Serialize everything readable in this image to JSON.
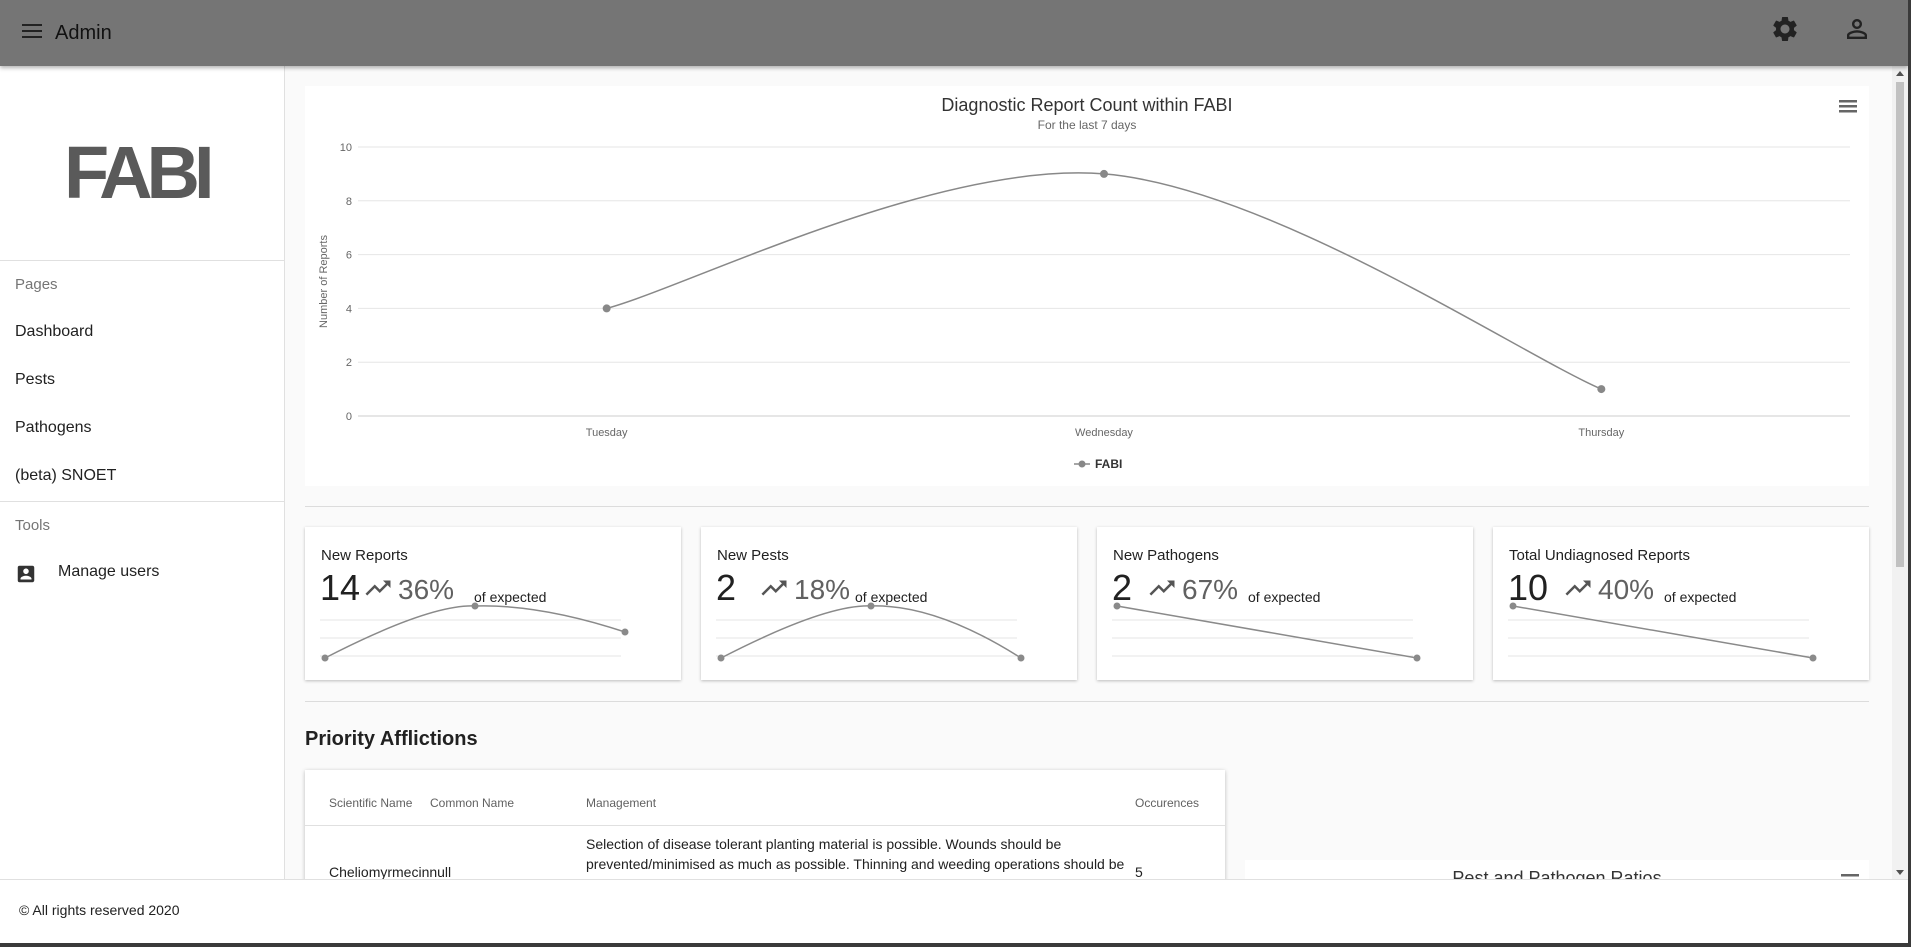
{
  "appbar": {
    "title": "Admin",
    "menu_icon": "menu-icon",
    "settings_icon": "gear-icon",
    "account_icon": "person-icon"
  },
  "sidebar": {
    "logo_text": "FABI",
    "pages_header": "Pages",
    "items": [
      {
        "label": "Dashboard"
      },
      {
        "label": "Pests"
      },
      {
        "label": "Pathogens"
      },
      {
        "label": "(beta) SNOET"
      }
    ],
    "tools_header": "Tools",
    "tools": [
      {
        "label": "Manage users",
        "icon": "account-box-icon"
      }
    ]
  },
  "chart_data": {
    "type": "line",
    "title": "Diagnostic Report Count within FABI",
    "subtitle": "For the last 7 days",
    "ylabel": "Number of Reports",
    "xlabel": "",
    "categories": [
      "Tuesday",
      "Wednesday",
      "Thursday"
    ],
    "series": [
      {
        "name": "FABI",
        "values": [
          4,
          9,
          1
        ]
      }
    ],
    "ylim": [
      0,
      10
    ],
    "yticks": [
      "0",
      "2",
      "4",
      "6",
      "8",
      "10"
    ],
    "grid": true,
    "legend": "bottom-center",
    "color": "#888888"
  },
  "stats": [
    {
      "title": "New Reports",
      "value": "14",
      "percent": "36%",
      "suffix": "of expected",
      "trend_icon": "trending-up-icon",
      "spark": [
        1,
        3,
        2
      ]
    },
    {
      "title": "New Pests",
      "value": "2",
      "percent": "18%",
      "suffix": "of expected",
      "trend_icon": "trending-up-icon",
      "spark": [
        1,
        3,
        1
      ]
    },
    {
      "title": "New Pathogens",
      "value": "2",
      "percent": "67%",
      "suffix": "of expected",
      "trend_icon": "trending-up-icon",
      "spark": [
        3,
        1
      ]
    },
    {
      "title": "Total Undiagnosed Reports",
      "value": "10",
      "percent": "40%",
      "suffix": "of expected",
      "trend_icon": "trending-up-icon",
      "spark": [
        3,
        1
      ]
    }
  ],
  "priority": {
    "title": "Priority Afflictions",
    "columns": [
      "Scientific Name",
      "Common Name",
      "Management",
      "Occurences"
    ],
    "rows": [
      {
        "scientific": "Cheliomyrmecinnull",
        "common": "",
        "management": "Selection of disease tolerant planting material is possible. Wounds should be prevented/minimised as much as possible. Thinning and weeding operations should be restricted to cooler, drier periods of the year and should be done on smaller diameter",
        "occurences": "5"
      }
    ]
  },
  "ratio_card": {
    "title": "Pest and Pathogen Ratios"
  },
  "footer": {
    "text": "© All rights reserved 2020"
  }
}
